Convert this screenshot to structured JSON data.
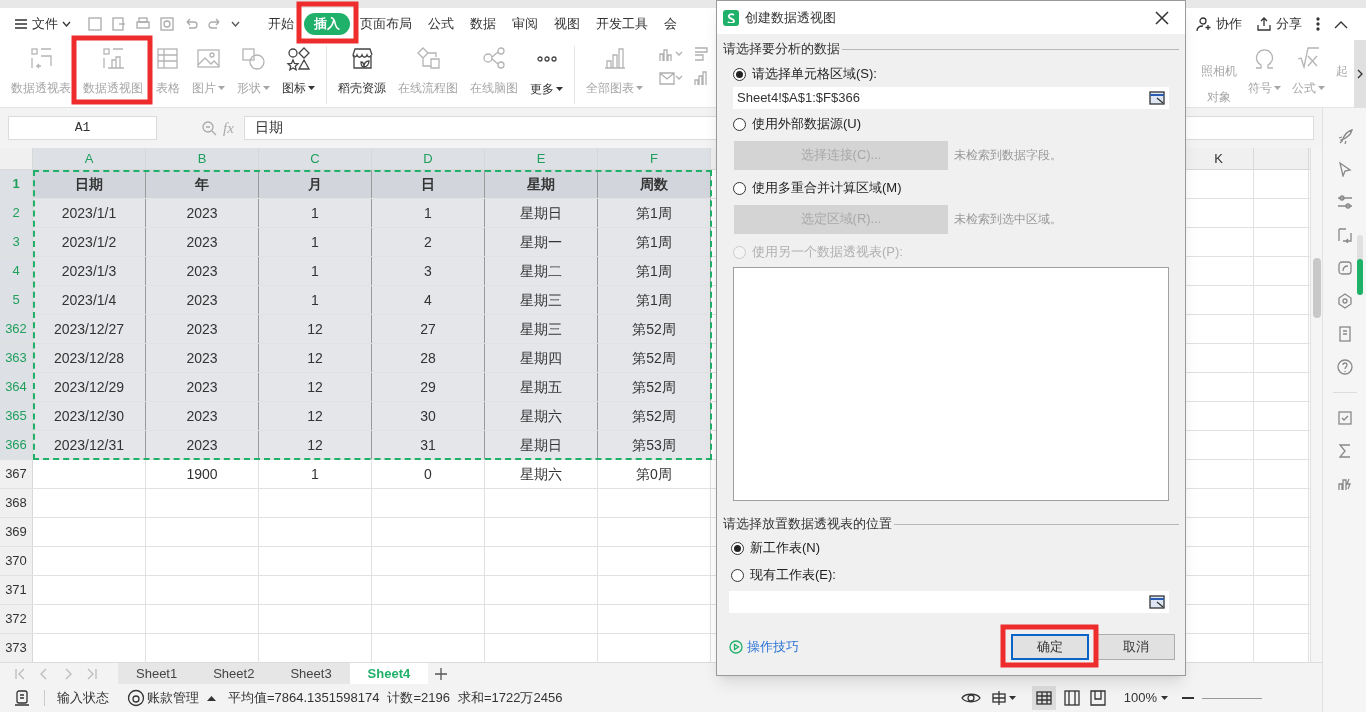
{
  "menu": {
    "file": "文件",
    "tabs": [
      {
        "label": "开始",
        "selected": false
      },
      {
        "label": "插入",
        "selected": true
      },
      {
        "label": "页面布局",
        "selected": false
      },
      {
        "label": "公式",
        "selected": false
      },
      {
        "label": "数据",
        "selected": false
      },
      {
        "label": "审阅",
        "selected": false
      },
      {
        "label": "视图",
        "selected": false
      },
      {
        "label": "开发工具",
        "selected": false
      },
      {
        "label": "会",
        "selected": false
      }
    ],
    "actions": [
      {
        "kind": "collab",
        "label": "协作"
      },
      {
        "kind": "share",
        "label": "分享"
      }
    ]
  },
  "ribbon": {
    "items": [
      {
        "kind": "pivot-table",
        "label": "数据透视表",
        "disabled": true,
        "dropdown": false
      },
      {
        "kind": "pivot-chart",
        "label": "数据透视图",
        "disabled": true,
        "dropdown": false
      },
      {
        "kind": "table",
        "label": "表格",
        "disabled": true,
        "dropdown": false
      },
      {
        "kind": "picture",
        "label": "图片",
        "disabled": true,
        "dropdown": true
      },
      {
        "kind": "shape",
        "label": "形状",
        "disabled": true,
        "dropdown": true
      },
      {
        "kind": "icons",
        "label": "图标",
        "disabled": false,
        "dropdown": true
      },
      {
        "kind": "store",
        "label": "稻壳资源",
        "disabled": false,
        "dropdown": false
      },
      {
        "kind": "flow",
        "label": "在线流程图",
        "disabled": true,
        "dropdown": false
      },
      {
        "kind": "mind",
        "label": "在线脑图",
        "disabled": true,
        "dropdown": false
      },
      {
        "kind": "more",
        "label": "更多",
        "disabled": false,
        "dropdown": true
      },
      {
        "kind": "chart",
        "label": "全部图表",
        "disabled": true,
        "dropdown": true
      }
    ],
    "right_items": [
      {
        "kind": "camera",
        "label": "照相机",
        "label_2": "对象",
        "disabled": true,
        "dropdown": false
      },
      {
        "kind": "symbol",
        "label": "符号",
        "disabled": true,
        "dropdown": true
      },
      {
        "kind": "formula",
        "label": "公式",
        "disabled": true,
        "dropdown": true
      },
      {
        "kind": "cut",
        "label": "起",
        "disabled": true,
        "dropdown": false
      }
    ]
  },
  "formula_bar": {
    "name_box": "A1",
    "fx": "fx",
    "value": "日期"
  },
  "sheet": {
    "columns": [
      {
        "label": "A",
        "selected": true
      },
      {
        "label": "B",
        "selected": true
      },
      {
        "label": "C",
        "selected": true
      },
      {
        "label": "D",
        "selected": true
      },
      {
        "label": "E",
        "selected": true
      },
      {
        "label": "F",
        "selected": true
      },
      {
        "label": "K",
        "selected": false
      }
    ],
    "rows": [
      {
        "number": "1",
        "selected": true,
        "header": true,
        "cells": [
          "日期",
          "年",
          "月",
          "日",
          "星期",
          "周数"
        ]
      },
      {
        "number": "2",
        "selected": true,
        "header": false,
        "cells": [
          "2023/1/1",
          "2023",
          "1",
          "1",
          "星期日",
          "第1周"
        ]
      },
      {
        "number": "3",
        "selected": true,
        "header": false,
        "cells": [
          "2023/1/2",
          "2023",
          "1",
          "2",
          "星期一",
          "第1周"
        ]
      },
      {
        "number": "4",
        "selected": true,
        "header": false,
        "cells": [
          "2023/1/3",
          "2023",
          "1",
          "3",
          "星期二",
          "第1周"
        ]
      },
      {
        "number": "5",
        "selected": true,
        "header": false,
        "cells": [
          "2023/1/4",
          "2023",
          "1",
          "4",
          "星期三",
          "第1周"
        ]
      },
      {
        "number": "362",
        "selected": true,
        "header": false,
        "cells": [
          "2023/12/27",
          "2023",
          "12",
          "27",
          "星期三",
          "第52周"
        ]
      },
      {
        "number": "363",
        "selected": true,
        "header": false,
        "cells": [
          "2023/12/28",
          "2023",
          "12",
          "28",
          "星期四",
          "第52周"
        ]
      },
      {
        "number": "364",
        "selected": true,
        "header": false,
        "cells": [
          "2023/12/29",
          "2023",
          "12",
          "29",
          "星期五",
          "第52周"
        ]
      },
      {
        "number": "365",
        "selected": true,
        "header": false,
        "cells": [
          "2023/12/30",
          "2023",
          "12",
          "30",
          "星期六",
          "第52周"
        ]
      },
      {
        "number": "366",
        "selected": true,
        "header": false,
        "cells": [
          "2023/12/31",
          "2023",
          "12",
          "31",
          "星期日",
          "第53周"
        ]
      },
      {
        "number": "367",
        "selected": false,
        "header": false,
        "cells": [
          "",
          "1900",
          "1",
          "0",
          "星期六",
          "第0周"
        ]
      },
      {
        "number": "368",
        "selected": false,
        "header": false,
        "cells": []
      },
      {
        "number": "369",
        "selected": false,
        "header": false,
        "cells": []
      },
      {
        "number": "370",
        "selected": false,
        "header": false,
        "cells": []
      },
      {
        "number": "371",
        "selected": false,
        "header": false,
        "cells": []
      },
      {
        "number": "372",
        "selected": false,
        "header": false,
        "cells": []
      },
      {
        "number": "373",
        "selected": false,
        "header": false,
        "cells": []
      }
    ]
  },
  "sheet_tabs": [
    {
      "label": "Sheet1",
      "selected": false
    },
    {
      "label": "Sheet2",
      "selected": false
    },
    {
      "label": "Sheet3",
      "selected": false
    },
    {
      "label": "Sheet4",
      "selected": true
    }
  ],
  "status_bar": {
    "mode": "输入状态",
    "ledger": "账款管理",
    "average": "平均值=7864.1351598174",
    "count": "计数=2196",
    "sum": "求和=1722万2456",
    "zoom": "100%"
  },
  "dialog": {
    "title": "创建数据透视图",
    "source_section": "请选择要分析的数据",
    "source_options": [
      {
        "kind": "range",
        "label": "请选择单元格区域(S):",
        "selected": true,
        "disabled": false,
        "value": "Sheet4!$A$1:$F$366"
      },
      {
        "kind": "button",
        "label": "使用外部数据源(U)",
        "selected": false,
        "disabled": false,
        "button": "选择连接(C)...",
        "note": "未检索到数据字段。"
      },
      {
        "kind": "button",
        "label": "使用多重合并计算区域(M)",
        "selected": false,
        "disabled": false,
        "button": "选定区域(R)...",
        "note": "未检索到选中区域。"
      },
      {
        "kind": "list",
        "label": "使用另一个数据透视表(P):",
        "selected": false,
        "disabled": true
      }
    ],
    "target_section": "请选择放置数据透视表的位置",
    "target_options": [
      {
        "kind": "plain",
        "label": "新工作表(N)",
        "selected": true
      },
      {
        "kind": "range",
        "label": "现有工作表(E):",
        "selected": false
      }
    ],
    "tips": "操作技巧",
    "ok": "确定",
    "cancel": "取消"
  }
}
